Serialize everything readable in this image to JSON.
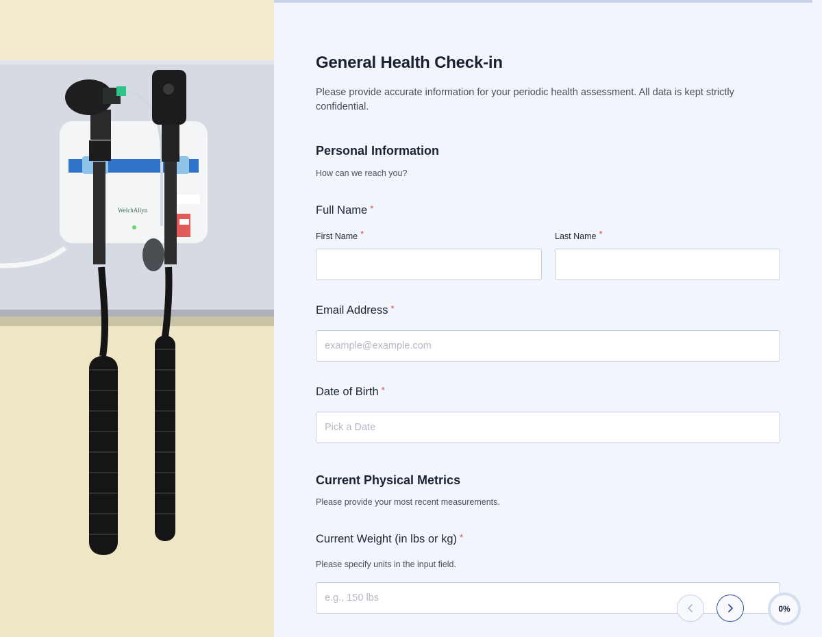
{
  "form": {
    "title": "General Health Check-in",
    "description": "Please provide accurate information for your periodic health assessment. All data is kept strictly confidential.",
    "required_marker": "*"
  },
  "personal": {
    "title": "Personal Information",
    "subtitle": "How can we reach you?",
    "full_name": {
      "label": "Full Name",
      "first_label": "First Name",
      "last_label": "Last Name",
      "first_value": "",
      "last_value": ""
    },
    "email": {
      "label": "Email Address",
      "placeholder": "example@example.com",
      "value": ""
    },
    "dob": {
      "label": "Date of Birth",
      "placeholder": "Pick a Date",
      "value": ""
    }
  },
  "metrics": {
    "title": "Current Physical Metrics",
    "subtitle": "Please provide your most recent measurements.",
    "weight": {
      "label": "Current Weight (in lbs or kg)",
      "help": "Please specify units in the input field.",
      "placeholder": "e.g., 150 lbs",
      "value": ""
    }
  },
  "navigation": {
    "prev_icon": "chevron-left-icon",
    "next_icon": "chevron-right-icon",
    "progress_label": "0%",
    "progress_fraction": 0
  },
  "image": {
    "brand_text": "WelchAllyn",
    "description_icon": "wall-mounted-otoscope-ophthalmoscope"
  },
  "colors": {
    "background": "#f1f5fc",
    "accent": "#2f4f8f",
    "required": "#e0474c",
    "input_border": "#c9ced9"
  }
}
